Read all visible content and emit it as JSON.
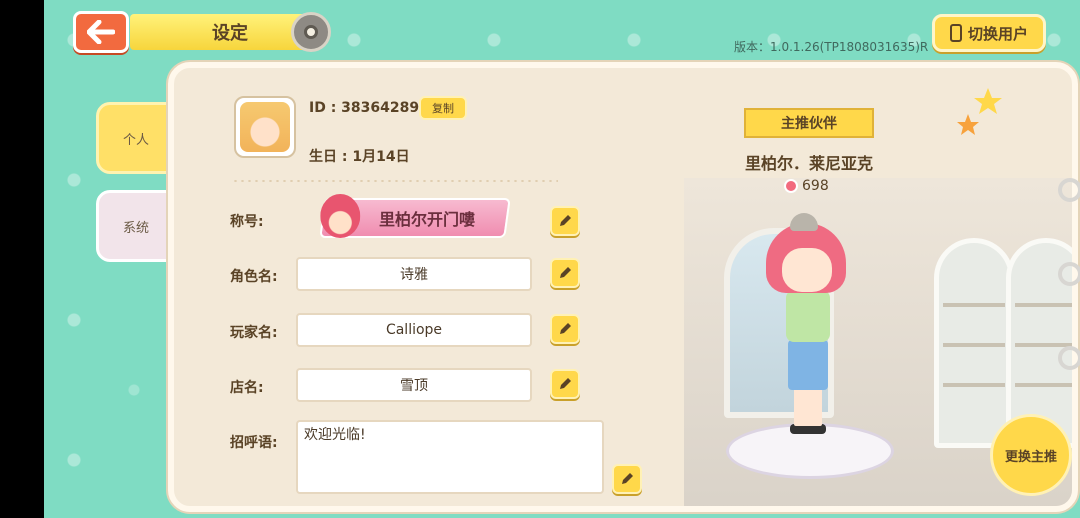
{
  "header": {
    "title": "设定",
    "version": "版本：1.0.1.26(TP1808031635)R",
    "switch_user": "切换用户"
  },
  "tabs": [
    {
      "label": "个人",
      "active": true
    },
    {
      "label": "系统",
      "active": false
    }
  ],
  "profile": {
    "id": "ID : 38364289",
    "copy_label": "复制",
    "birthday": "生日 : 1月14日",
    "title_label": "称号:",
    "title_value": "里柏尔开门嘍",
    "character_label": "角色名:",
    "character_value": "诗雅",
    "player_label": "玩家名:",
    "player_value": "Calliope",
    "shop_label": "店名:",
    "shop_value": "雪顶",
    "greeting_label": "招呼语:",
    "greeting_value": "欢迎光临!"
  },
  "partner": {
    "ribbon": "主推伙伴",
    "name": "里柏尔．莱尼亚克",
    "affection": "698",
    "switch_label": "更换主推"
  },
  "colors": {
    "background": "#7fdcc3",
    "accent": "#ffd84a",
    "back_button": "#f26a3f"
  }
}
